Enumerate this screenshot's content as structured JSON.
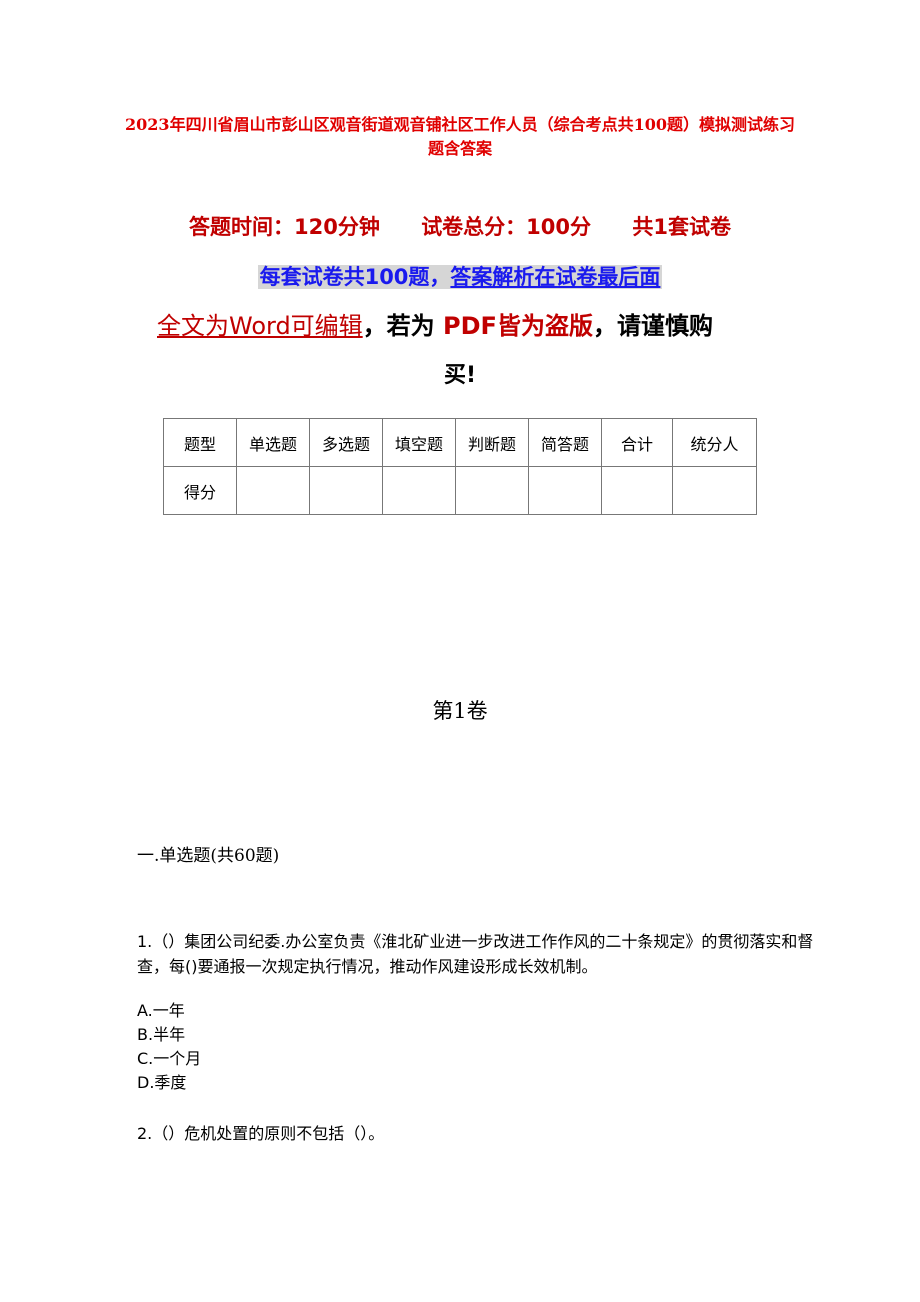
{
  "document": {
    "title": "2023年四川省眉山市彭山区观音街道观音铺社区工作人员（综合考点共100题）模拟测试练习题含答案",
    "info": {
      "time": "答题时间：120分钟",
      "total": "试卷总分：100分",
      "sets": "共1套试卷"
    },
    "notice": {
      "part1": "每套试卷共100题，",
      "part2": "答案解析在试卷最后面"
    },
    "editable": {
      "part1": "全文为Word可编辑",
      "comma1": "，若为 ",
      "part2": "PDF皆为盗版",
      "part3": "，请谨慎购",
      "part4": "买!"
    },
    "score_table": {
      "headers": [
        "题型",
        "单选题",
        "多选题",
        "填空题",
        "判断题",
        "简答题",
        "合计",
        "统分人"
      ],
      "row_label": "得分"
    },
    "volume": "第1卷",
    "section": "一.单选题(共60题)",
    "questions": [
      {
        "text": "1.（）集团公司纪委.办公室负责《淮北矿业进一步改进工作作风的二十条规定》的贯彻落实和督查，每()要通报一次规定执行情况，推动作风建设形成长效机制。",
        "options": [
          "A.一年",
          "B.半年",
          "C.一个月",
          "D.季度"
        ]
      },
      {
        "text": "2.（）危机处置的原则不包括（）。"
      }
    ]
  }
}
